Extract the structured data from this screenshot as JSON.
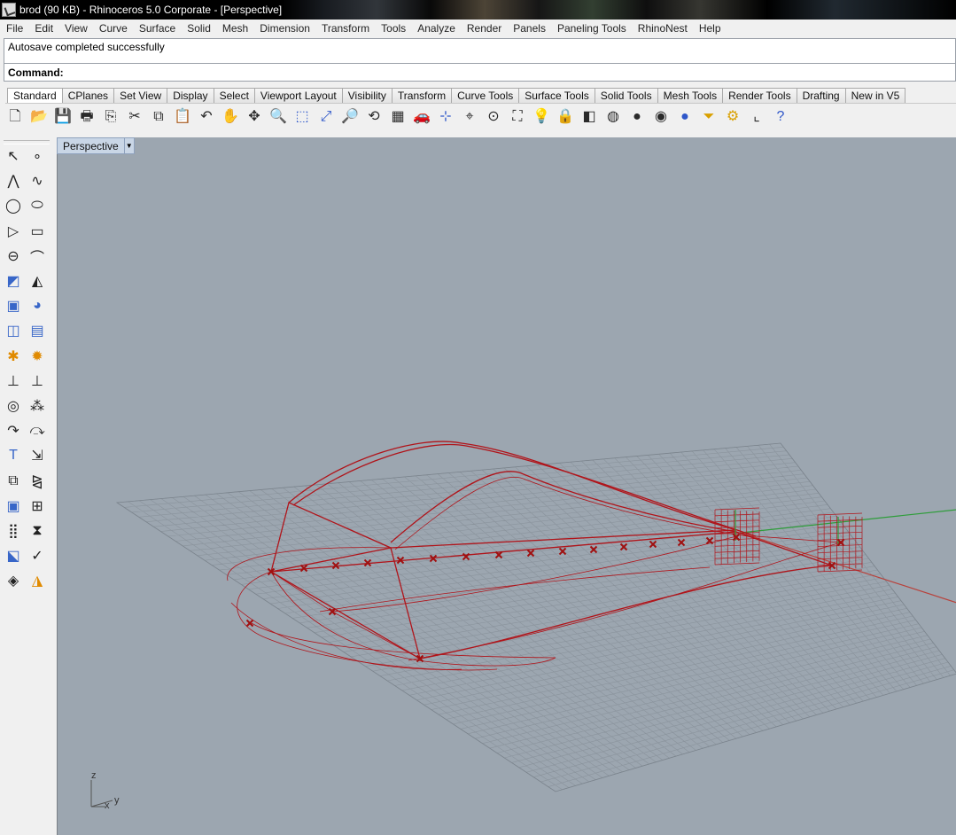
{
  "window": {
    "title": "brod (90 KB) - Rhinoceros  5.0 Corporate - [Perspective]"
  },
  "menu": [
    "File",
    "Edit",
    "View",
    "Curve",
    "Surface",
    "Solid",
    "Mesh",
    "Dimension",
    "Transform",
    "Tools",
    "Analyze",
    "Render",
    "Panels",
    "Paneling Tools",
    "RhinoNest",
    "Help"
  ],
  "history": {
    "line": "Autosave completed successfully"
  },
  "command": {
    "label": "Command:",
    "value": ""
  },
  "tabs": [
    "Standard",
    "CPlanes",
    "Set View",
    "Display",
    "Select",
    "Viewport Layout",
    "Visibility",
    "Transform",
    "Curve Tools",
    "Surface Tools",
    "Solid Tools",
    "Mesh Tools",
    "Render Tools",
    "Drafting",
    "New in V5"
  ],
  "active_tab": "Standard",
  "toolbar_icons": [
    {
      "name": "new-icon",
      "glyph": "🗋"
    },
    {
      "name": "open-icon",
      "glyph": "📂"
    },
    {
      "name": "save-icon",
      "glyph": "💾"
    },
    {
      "name": "print-icon",
      "glyph": "🖶"
    },
    {
      "name": "export-icon",
      "glyph": "⎘"
    },
    {
      "name": "cut-icon",
      "glyph": "✂"
    },
    {
      "name": "copy-icon",
      "glyph": "⧉"
    },
    {
      "name": "paste-icon",
      "glyph": "📋"
    },
    {
      "name": "undo-icon",
      "glyph": "↶"
    },
    {
      "name": "pan-icon",
      "glyph": "✋"
    },
    {
      "name": "rotate-view-icon",
      "glyph": "✥"
    },
    {
      "name": "zoom-icon",
      "glyph": "🔍"
    },
    {
      "name": "zoom-window-icon",
      "glyph": "⬚"
    },
    {
      "name": "zoom-extents-icon",
      "glyph": "⤢"
    },
    {
      "name": "zoom-selected-icon",
      "glyph": "🔎"
    },
    {
      "name": "undo-view-icon",
      "glyph": "⟲"
    },
    {
      "name": "four-viewports-icon",
      "glyph": "▦"
    },
    {
      "name": "car-icon",
      "glyph": "🚗"
    },
    {
      "name": "cplane-icon",
      "glyph": "⊹"
    },
    {
      "name": "grid-icon",
      "glyph": "⌖"
    },
    {
      "name": "snap-icon",
      "glyph": "⊙"
    },
    {
      "name": "object-properties-icon",
      "glyph": "⛶"
    },
    {
      "name": "light-icon",
      "glyph": "💡"
    },
    {
      "name": "lock-icon",
      "glyph": "🔒"
    },
    {
      "name": "layer-icon",
      "glyph": "◧"
    },
    {
      "name": "color-wheel-icon",
      "glyph": "◍"
    },
    {
      "name": "shaded-sphere-icon",
      "glyph": "●"
    },
    {
      "name": "render-sphere-icon",
      "glyph": "◉"
    },
    {
      "name": "blue-sphere-icon",
      "glyph": "●"
    },
    {
      "name": "filter-icon",
      "glyph": "⏷"
    },
    {
      "name": "gear-options-icon",
      "glyph": "⚙"
    },
    {
      "name": "gumball-icon",
      "glyph": "⌞"
    },
    {
      "name": "help-icon",
      "glyph": "?"
    }
  ],
  "left_icons": [
    {
      "name": "select-arrow-icon",
      "glyph": "↖"
    },
    {
      "name": "point-icon",
      "glyph": "∘"
    },
    {
      "name": "polyline-icon",
      "glyph": "⋀"
    },
    {
      "name": "curve-icon",
      "glyph": "∿"
    },
    {
      "name": "circle-icon",
      "glyph": "◯"
    },
    {
      "name": "ellipse-icon",
      "glyph": "⬭"
    },
    {
      "name": "polygon-icon",
      "glyph": "▷"
    },
    {
      "name": "rectangle-icon",
      "glyph": "▭"
    },
    {
      "name": "arc-icon",
      "glyph": "⊖"
    },
    {
      "name": "fillet-curve-icon",
      "glyph": "⌒"
    },
    {
      "name": "surface-corner-icon",
      "glyph": "◩"
    },
    {
      "name": "loft-icon",
      "glyph": "◭"
    },
    {
      "name": "box-solid-icon",
      "glyph": "▣"
    },
    {
      "name": "sphere-solid-icon",
      "glyph": "◕"
    },
    {
      "name": "extrude-icon",
      "glyph": "◫"
    },
    {
      "name": "mesh-plane-icon",
      "glyph": "▤"
    },
    {
      "name": "explode-icon",
      "glyph": "✱"
    },
    {
      "name": "burst-icon",
      "glyph": "✹"
    },
    {
      "name": "trim-icon",
      "glyph": "⊥"
    },
    {
      "name": "split-icon",
      "glyph": "⊥"
    },
    {
      "name": "boolean-union-icon",
      "glyph": "◎"
    },
    {
      "name": "boolean-icon",
      "glyph": "⁂"
    },
    {
      "name": "offset-curve-icon",
      "glyph": "↷"
    },
    {
      "name": "blend-curve-icon",
      "glyph": "⤼"
    },
    {
      "name": "text-icon",
      "glyph": "T"
    },
    {
      "name": "scale-icon",
      "glyph": "⇲"
    },
    {
      "name": "group-icon",
      "glyph": "⧉"
    },
    {
      "name": "mirror-icon",
      "glyph": "⧎"
    },
    {
      "name": "cube-icon",
      "glyph": "▣"
    },
    {
      "name": "dimension-icon",
      "glyph": "⊞"
    },
    {
      "name": "array-icon",
      "glyph": "⣿"
    },
    {
      "name": "orient-icon",
      "glyph": "⧗"
    },
    {
      "name": "analyze-icon",
      "glyph": "⬕"
    },
    {
      "name": "check-icon",
      "glyph": "✓"
    },
    {
      "name": "render-icon",
      "glyph": "◈"
    },
    {
      "name": "paint-icon",
      "glyph": "◮"
    }
  ],
  "viewport": {
    "label": "Perspective",
    "axes": {
      "x": "x",
      "y": "y",
      "z": "z"
    }
  }
}
